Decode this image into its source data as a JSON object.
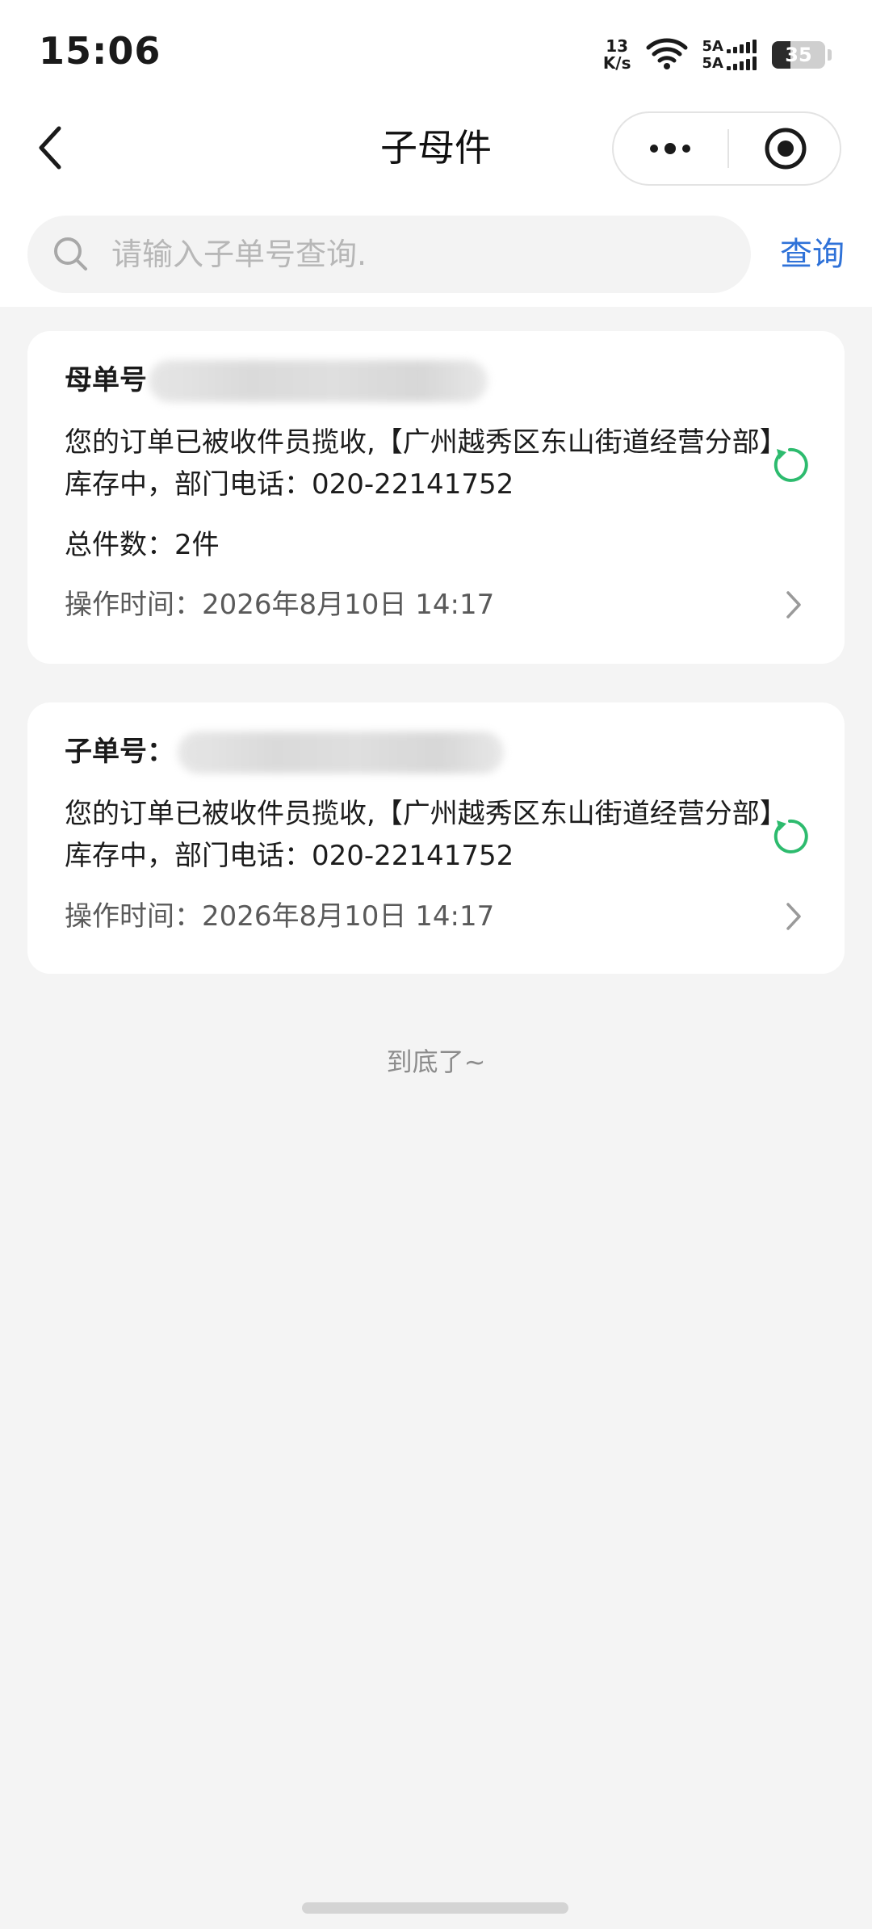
{
  "status_bar": {
    "time": "15:06",
    "net_speed_value": "13",
    "net_speed_unit": "K/s",
    "sim1_label": "5A",
    "sim2_label": "5A",
    "battery_level": "35"
  },
  "nav": {
    "title": "子母件",
    "back_icon": "chevron-left-icon",
    "more_icon": "more-dots-icon",
    "close_icon": "target-circle-icon"
  },
  "search": {
    "placeholder": "请输入子单号查询.",
    "value": "",
    "button_label": "查询"
  },
  "cards": [
    {
      "label": "母单号",
      "description_line1": "您的订单已被收件员揽收,【广州越秀区东山街道经营分部】",
      "description_line2": "库存中，部门电话：020-22141752",
      "total_count": "总件数：2件",
      "operation_time": "操作时间：2026年8月10日 14:17"
    },
    {
      "label": "子单号：",
      "description_line1": "您的订单已被收件员揽收,【广州越秀区东山街道经营分部】",
      "description_line2": "库存中，部门电话：020-22141752",
      "operation_time": "操作时间：2026年8月10日 14:17"
    }
  ],
  "footer": {
    "end_text": "到底了~"
  },
  "colors": {
    "accent_blue": "#2f72d8",
    "refresh_green": "#2dbb6e",
    "background": "#f4f4f4"
  }
}
